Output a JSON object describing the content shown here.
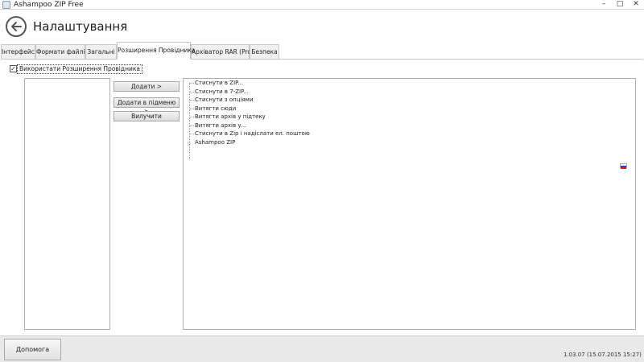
{
  "window": {
    "title": "Ashampoo ZIP Free",
    "controls": {
      "minimize": "–",
      "maximize": "□",
      "close": "✕"
    }
  },
  "header": {
    "title": "Налаштування",
    "back_icon": "back-arrow-icon"
  },
  "tabs": [
    {
      "label": "Інтерфейс",
      "active": false
    },
    {
      "label": "Формати файлів",
      "active": false
    },
    {
      "label": "Загальні",
      "active": false
    },
    {
      "label": "Розширення Провідника",
      "active": true
    },
    {
      "label": "Архіватор RAR (Pro)",
      "active": false
    },
    {
      "label": "Безпека",
      "active": false
    }
  ],
  "explorer_ext": {
    "checkbox_label": "Використати Розширення Провідника",
    "checkbox_checked": true,
    "checkbox_mark": "✓",
    "buttons": {
      "add": "Додати >",
      "add_submenu": "Додати в підменю >",
      "remove": "Вилучити"
    },
    "tree_items": [
      "Стиснути в ZIP...",
      "Стиснути в 7-ZIP...",
      "Стиснути з опціями",
      "Витягти сюди",
      "Витягти архів у підтеку",
      "Витягти архів у...",
      "Стиснути в Zip і надіслати ел. поштою",
      "Ashampoo ZIP"
    ],
    "expander_glyph": "▷"
  },
  "language_flag": {
    "icon": "russia-flag-icon",
    "colors": [
      "#ffffff",
      "#2a3fd0",
      "#d82020"
    ]
  },
  "footer": {
    "help_label": "Допомога",
    "version": "1.03.07 (15.07.2015 15:27)"
  }
}
